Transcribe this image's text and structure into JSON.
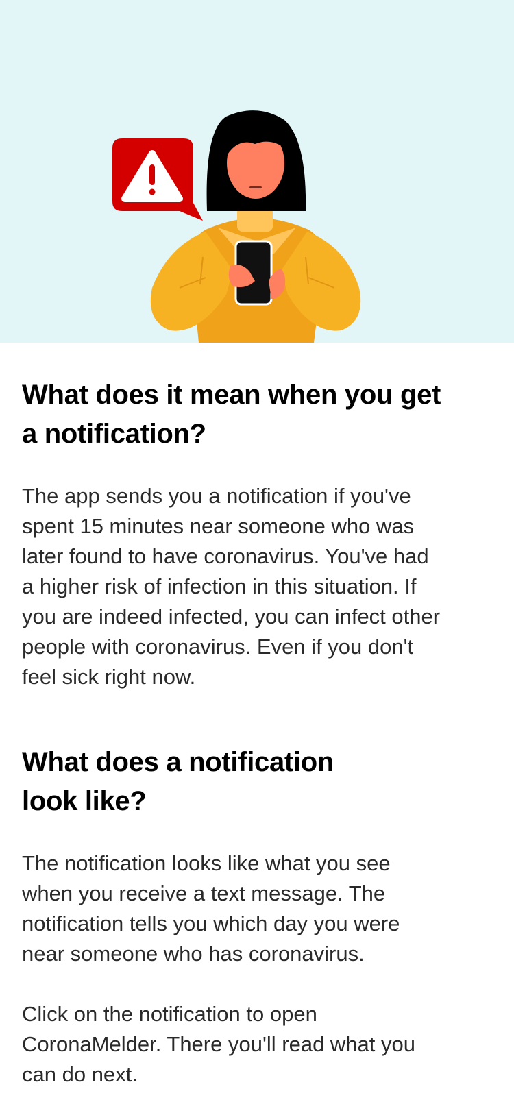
{
  "illustration": {
    "name": "woman-holding-phone-with-warning-notification",
    "icon": "warning-icon",
    "colors": {
      "background": "#e2f5f7",
      "alert_red": "#d40000",
      "sweater": "#f6b223",
      "skin": "#ff7f61",
      "hair": "#000000"
    }
  },
  "sections": [
    {
      "heading_lines": [
        "What does it mean when you get",
        "a notification?"
      ],
      "paragraphs": [
        {
          "lines": [
            "The app sends you a notification if you've",
            "spent 15 minutes near someone who was",
            "later found to have coronavirus. You've had",
            "a higher risk of infection in this situation. If",
            "you are indeed infected, you can infect other",
            "people with coronavirus. Even if you don't",
            "feel sick right now."
          ]
        }
      ]
    },
    {
      "heading_lines": [
        "What does a notification",
        "look like?"
      ],
      "paragraphs": [
        {
          "lines": [
            "The notification looks like what you see",
            "when you receive a text message. The",
            "notification tells you which day you were",
            "near someone who has coronavirus."
          ]
        },
        {
          "lines": [
            "Click on the notification to open",
            "CoronaMelder. There you'll read what you",
            "can do next."
          ]
        }
      ]
    }
  ]
}
